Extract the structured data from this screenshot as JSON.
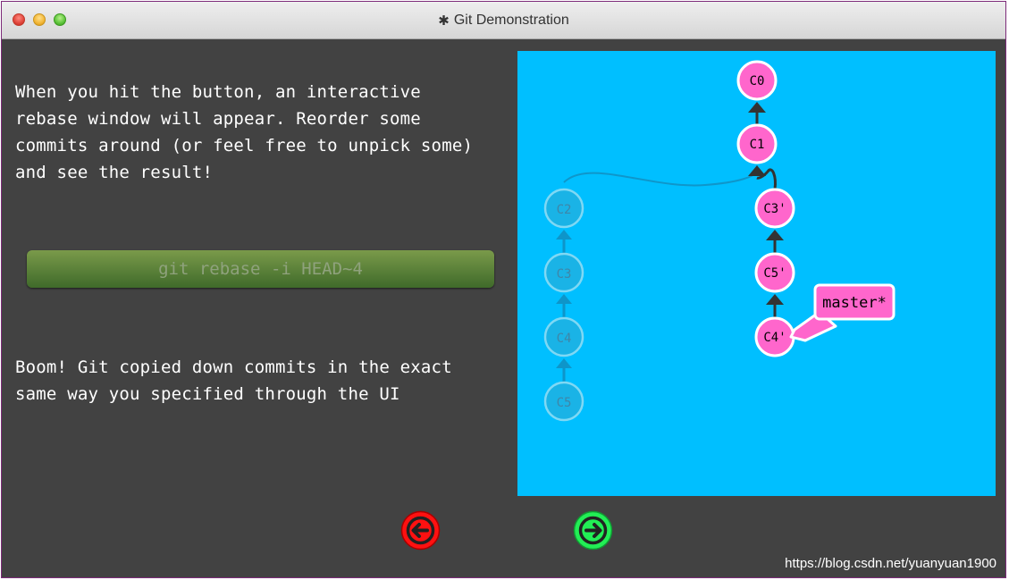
{
  "window": {
    "title": "Git Demonstration",
    "title_icon": "gear-icon"
  },
  "intro_lines": [
    "When you hit the button, an interactive",
    "rebase window will appear. Reorder some",
    "commits around (or feel free to unpick some)",
    "and see the result!"
  ],
  "command_button": {
    "label": "git rebase -i HEAD~4"
  },
  "outro_lines": [
    "Boom! Git copied down commits in the exact",
    "same way you specified through the UI"
  ],
  "graph": {
    "active_commits": [
      "C0",
      "C1",
      "C3'",
      "C5'",
      "C4'"
    ],
    "faded_commits": [
      "C2",
      "C3",
      "C4",
      "C5"
    ],
    "branch_label": "master*",
    "colors": {
      "background": "#00bfff",
      "commit": "#ff66cc",
      "faded": "#1bb4e8",
      "edge": "#333333"
    }
  },
  "nav": {
    "back_icon": "arrow-left-icon",
    "back_color": "#ff0000",
    "forward_icon": "arrow-right-icon",
    "forward_color": "#22ee55"
  },
  "watermark": "https://blog.csdn.net/yuanyuan1900"
}
